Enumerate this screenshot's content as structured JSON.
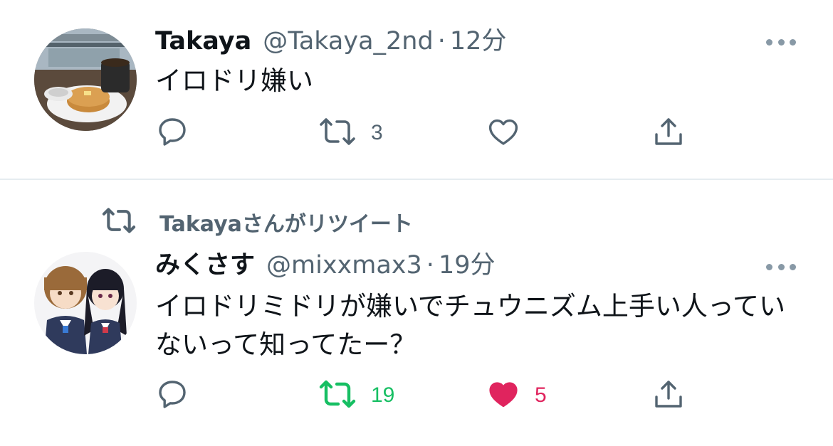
{
  "tweets": [
    {
      "name": "Takaya",
      "handle": "@Takaya_2nd",
      "separator": "·",
      "time": "12分",
      "text": "イロドリ嫌い",
      "reply_count": "",
      "retweet_count": "3",
      "like_count": "",
      "retweeted": false,
      "liked": false,
      "avatar": "coffee-pancake-photo"
    },
    {
      "retweet_context": "Takayaさんがリツイート",
      "name": "みくさす",
      "handle": "@mixxmax3",
      "separator": "·",
      "time": "19分",
      "text": "イロドリミドリが嫌いでチュウニズム上手い人っていないって知ってたー？",
      "reply_count": "",
      "retweet_count": "19",
      "like_count": "5",
      "retweeted": true,
      "liked": true,
      "avatar": "anime-girls-illustration"
    }
  ],
  "colors": {
    "text": "#0f1419",
    "secondary": "#536471",
    "retweet_active": "#17bf63",
    "like_active": "#e0245e",
    "divider": "#e6ecf0"
  },
  "icons": [
    "reply-icon",
    "retweet-icon",
    "like-icon",
    "share-icon",
    "more-icon"
  ]
}
